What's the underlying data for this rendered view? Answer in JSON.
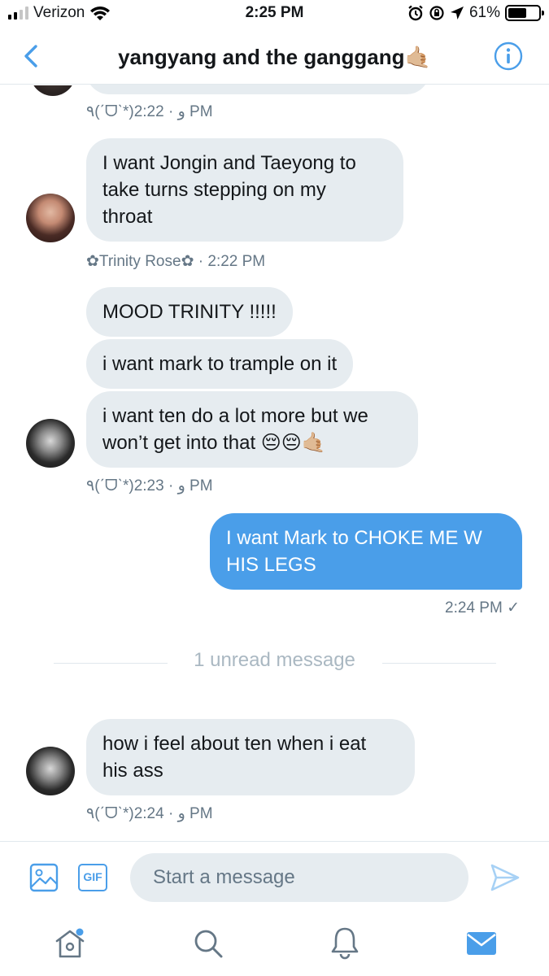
{
  "status_bar": {
    "carrier": "Verizon",
    "time": "2:25 PM",
    "battery_text": "61%",
    "battery_level": 0.61
  },
  "header": {
    "title": "yangyang and the ganggang🤙🏼",
    "back_icon": "chevron-left-icon",
    "info_icon": "info-icon"
  },
  "messages": {
    "top_meta": "٩(ˊᗜˋ*)و · 2:22 PM",
    "m1": {
      "lines": [
        "I want Jongin and Taeyong to",
        "take turns stepping on my",
        "throat"
      ],
      "meta": "✿Trinity Rose✿ · 2:22 PM"
    },
    "m2": {
      "text": "MOOD TRINITY !!!!!"
    },
    "m3": {
      "text": "i want mark to trample on it"
    },
    "m4": {
      "lines": [
        "i want ten do a lot more but we",
        "won’t get into that 😔😔🤙🏼"
      ],
      "meta": "٩(ˊᗜˋ*)و · 2:23 PM"
    },
    "m5": {
      "lines": [
        "I want Mark to CHOKE ME W",
        "HIS LEGS"
      ],
      "meta": "2:24 PM ✓"
    },
    "unread_divider": "1 unread message",
    "m6": {
      "lines": [
        "how i feel about ten when i eat",
        "his ass"
      ],
      "meta": "٩(ˊᗜˋ*)و · 2:24 PM"
    }
  },
  "composer": {
    "placeholder": "Start a message",
    "gif_label": "GIF"
  },
  "tabbar": {
    "items": [
      "home-icon",
      "search-icon",
      "notifications-icon",
      "messages-icon"
    ]
  },
  "colors": {
    "accent": "#4a9ee9",
    "bubble_received": "#e6ecf0",
    "meta_text": "#657786"
  }
}
